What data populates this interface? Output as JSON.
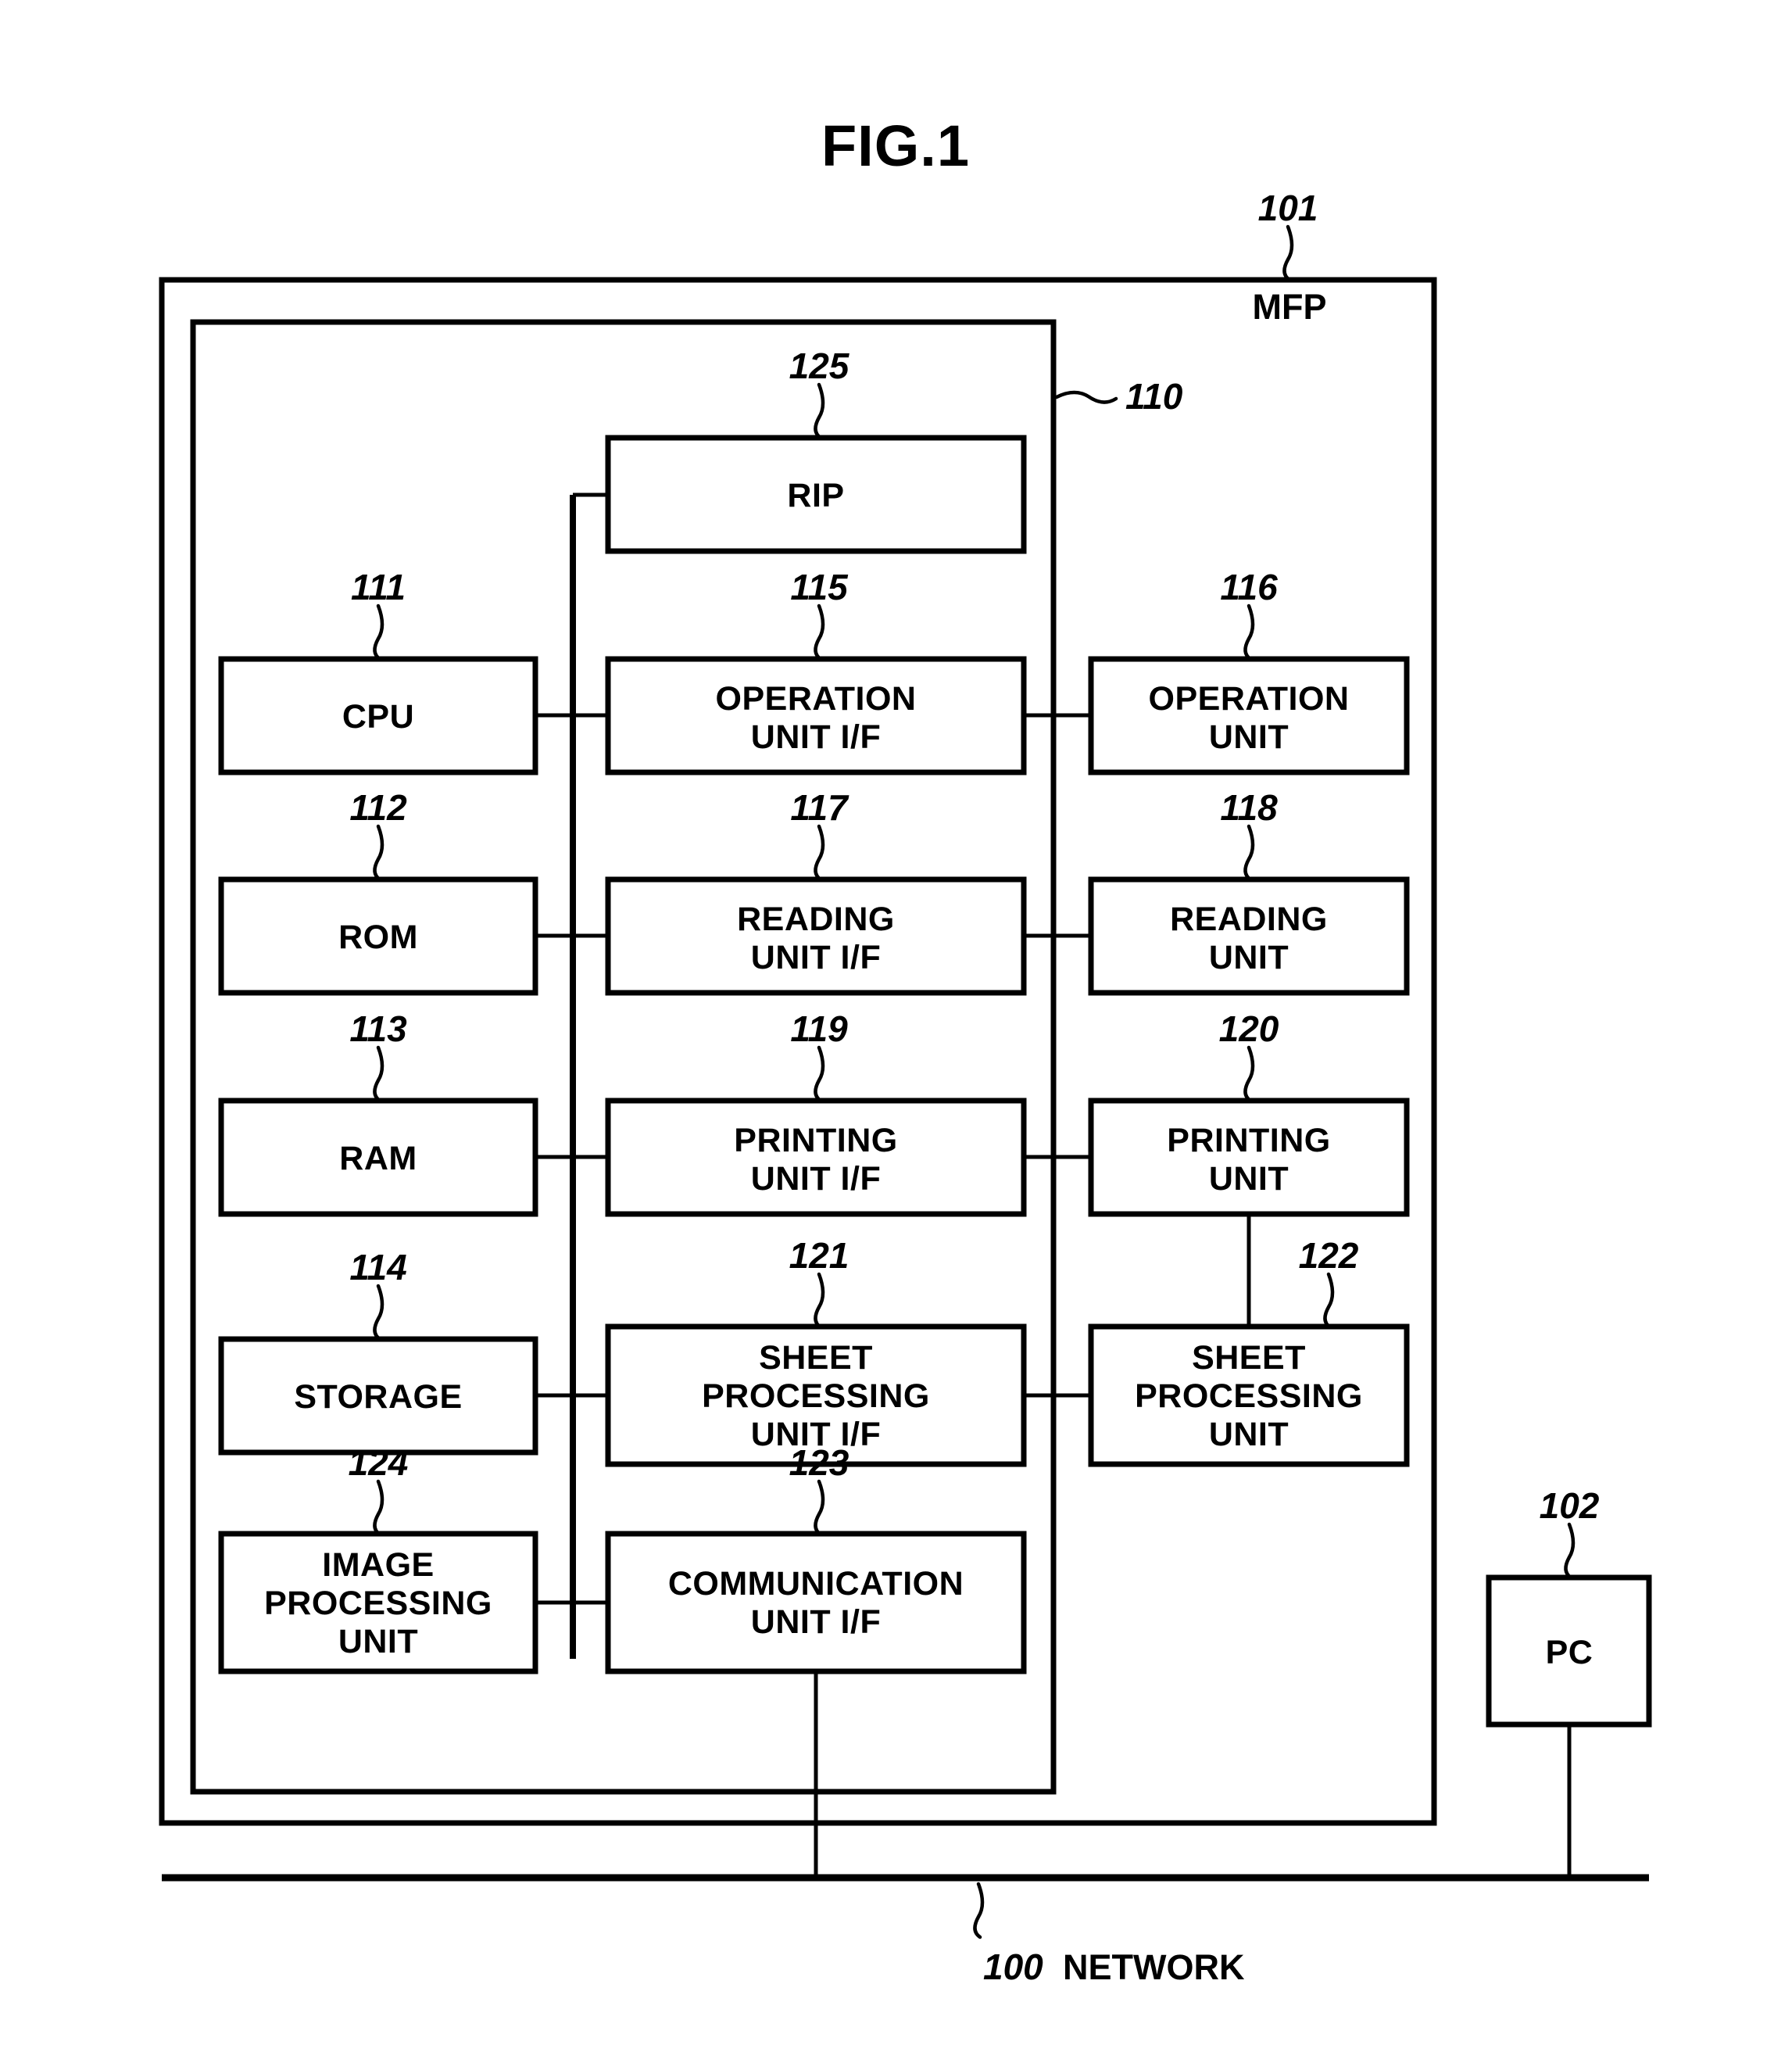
{
  "figure": {
    "title": "FIG.1"
  },
  "outer": {
    "mfp_ref": "101",
    "mfp_label": "MFP",
    "controller_ref": "110"
  },
  "blocks": {
    "rip": {
      "ref": "125",
      "label": "RIP"
    },
    "cpu": {
      "ref": "111",
      "label": "CPU"
    },
    "rom": {
      "ref": "112",
      "label": "ROM"
    },
    "ram": {
      "ref": "113",
      "label": "RAM"
    },
    "storage": {
      "ref": "114",
      "label": "STORAGE"
    },
    "image_processing_unit": {
      "ref": "124",
      "line1": "IMAGE",
      "line2": "PROCESSING",
      "line3": "UNIT"
    },
    "operation_unit_if": {
      "ref": "115",
      "line1": "OPERATION",
      "line2": "UNIT I/F"
    },
    "reading_unit_if": {
      "ref": "117",
      "line1": "READING",
      "line2": "UNIT I/F"
    },
    "printing_unit_if": {
      "ref": "119",
      "line1": "PRINTING",
      "line2": "UNIT I/F"
    },
    "sheet_processing_unit_if": {
      "ref": "121",
      "line1": "SHEET",
      "line2": "PROCESSING",
      "line3": "UNIT I/F"
    },
    "communication_unit_if": {
      "ref": "123",
      "line1": "COMMUNICATION",
      "line2": "UNIT I/F"
    },
    "operation_unit": {
      "ref": "116",
      "line1": "OPERATION",
      "line2": "UNIT"
    },
    "reading_unit": {
      "ref": "118",
      "line1": "READING",
      "line2": "UNIT"
    },
    "printing_unit": {
      "ref": "120",
      "line1": "PRINTING",
      "line2": "UNIT"
    },
    "sheet_processing_unit": {
      "ref": "122",
      "line1": "SHEET",
      "line2": "PROCESSING",
      "line3": "UNIT"
    },
    "pc": {
      "ref": "102",
      "label": "PC"
    }
  },
  "network": {
    "ref": "100",
    "label": "NETWORK"
  },
  "colors": {
    "stroke": "#000000",
    "fill": "#ffffff"
  }
}
